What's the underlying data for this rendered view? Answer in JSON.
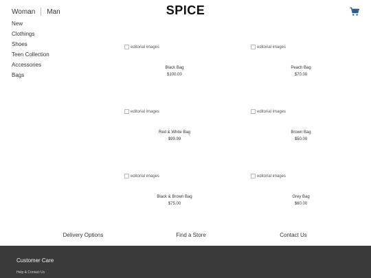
{
  "header": {
    "nav": {
      "woman": "Woman",
      "man": "Man"
    },
    "logo": "SPICE",
    "cart_icon": "shopping-cart-icon"
  },
  "sidebar": {
    "items": [
      {
        "label": "New"
      },
      {
        "label": "Clothings"
      },
      {
        "label": "Shoes"
      },
      {
        "label": "Teen Collection"
      },
      {
        "label": "Accessories"
      },
      {
        "label": "Bags"
      }
    ]
  },
  "products": [
    {
      "image_alt": "editorial images",
      "name": "Black Bag",
      "price": "$100.00"
    },
    {
      "image_alt": "editorial images",
      "name": "Peach Bag",
      "price": "$70.00"
    },
    {
      "image_alt": "editorial images",
      "name": "Red & White Bag",
      "price": "$99.99"
    },
    {
      "image_alt": "editorial images",
      "name": "Brown Bag",
      "price": "$50.00"
    },
    {
      "image_alt": "editorial images",
      "name": "Black & Brown Bag",
      "price": "$75.00"
    },
    {
      "image_alt": "editorial images",
      "name": "Grey Bag",
      "price": "$60.00"
    }
  ],
  "bottom_links": {
    "delivery": "Delivery Options",
    "store": "Find a Store",
    "contact": "Contact Us"
  },
  "footer": {
    "heading": "Customer Care",
    "link": "Help & Contact Us"
  },
  "colors": {
    "footer_bg": "#3a3a3a",
    "cart_icon": "#2a5d8f"
  }
}
